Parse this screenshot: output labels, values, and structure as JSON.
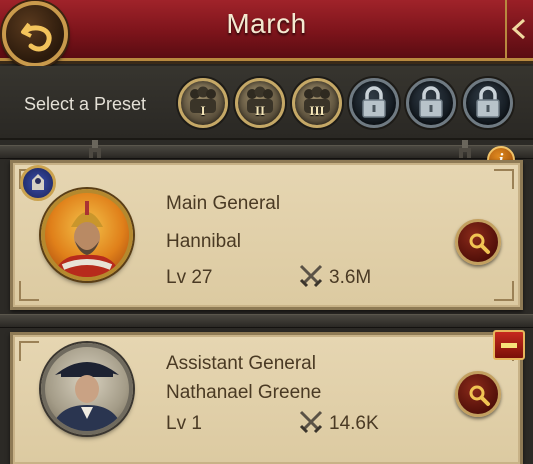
{
  "header": {
    "title": "March"
  },
  "presets": {
    "label": "Select a Preset",
    "items": [
      {
        "numeral": "I",
        "locked": false
      },
      {
        "numeral": "II",
        "locked": false
      },
      {
        "numeral": "III",
        "locked": false
      },
      {
        "numeral": "",
        "locked": true
      },
      {
        "numeral": "",
        "locked": true
      },
      {
        "numeral": "",
        "locked": true
      }
    ]
  },
  "generals": [
    {
      "role": "Main General",
      "name": "Hannibal",
      "level": "Lv 27",
      "power": "3.6M"
    },
    {
      "role": "Assistant General",
      "name": "Nathanael Greene",
      "level": "Lv 1",
      "power": "14.6K"
    }
  ],
  "colors": {
    "header_red": "#8a1a20",
    "card_bg": "#e2d1ab",
    "gold": "#c99a4c",
    "text": "#4a3a24"
  },
  "icons": [
    "back-arrow-icon",
    "soldiers-icon",
    "lock-icon",
    "crossed-swords-icon",
    "magnifier-icon",
    "info-icon",
    "minus-icon"
  ]
}
